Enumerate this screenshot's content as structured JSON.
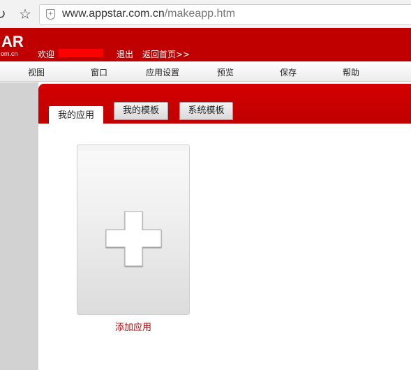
{
  "browser": {
    "url_host": "www.appstar.com.cn",
    "url_path": "/makeapp.htm"
  },
  "header": {
    "logo": "AR",
    "logo_sub": "om.cn",
    "welcome": "欢迎",
    "logout": "退出",
    "home": "返回首页>>",
    "mask_color": "#ff0000"
  },
  "menu": {
    "items": [
      "视图",
      "窗口",
      "应用设置",
      "预览",
      "保存",
      "帮助"
    ]
  },
  "tabs": [
    {
      "label": "我的应用",
      "active": true
    },
    {
      "label": "我的模板",
      "active": false
    },
    {
      "label": "系统模板",
      "active": false
    }
  ],
  "content": {
    "add_label": "添加应用"
  },
  "colors": {
    "brand_red": "#c00000",
    "link_red": "#c00000"
  }
}
